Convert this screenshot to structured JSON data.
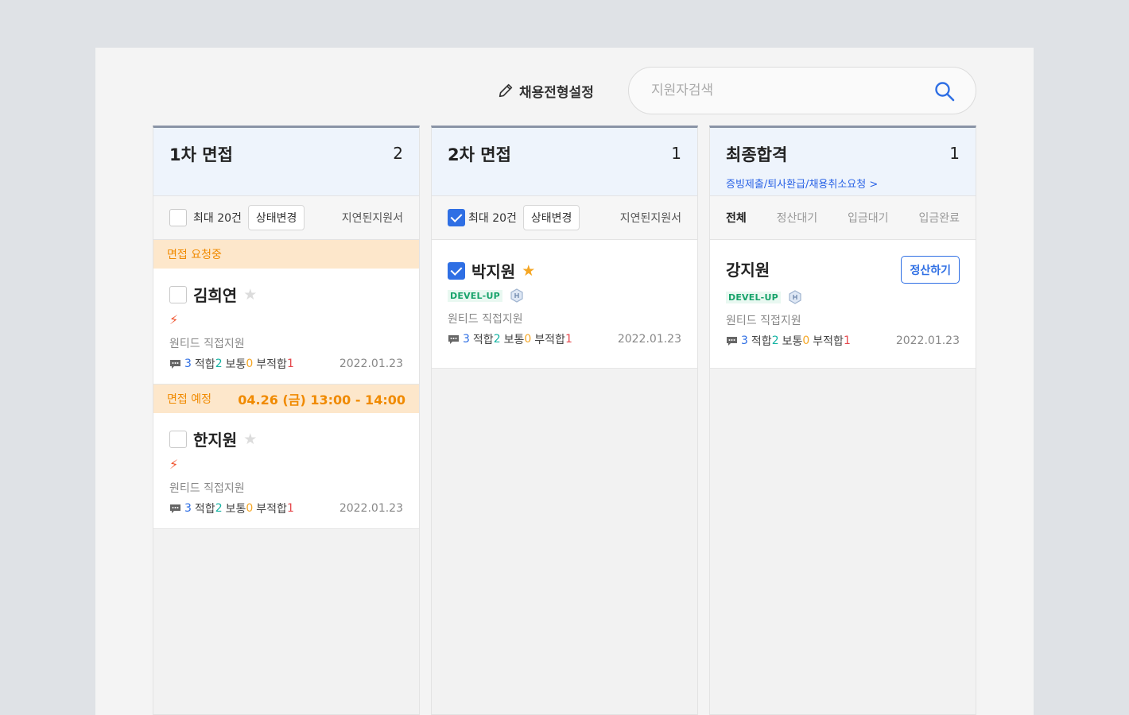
{
  "header": {
    "edit_label": "채용전형설정",
    "search_placeholder": "지원자검색"
  },
  "columns": [
    {
      "title": "1차 면접",
      "count": "2",
      "toolbar": {
        "max_label": "최대 20건",
        "status_button": "상태변경",
        "delayed_link": "지연된지원서",
        "checked": false
      },
      "groups": [
        {
          "band_label": "면접 요청중",
          "band_time": "",
          "card": {
            "name": "김희연",
            "starred": false,
            "source": "원티드 직접지원",
            "comments": "3",
            "fit_label": "적합",
            "fit": "2",
            "normal_label": "보통",
            "normal": "0",
            "unfit_label": "부적합",
            "unfit": "1",
            "date": "2022.01.23"
          }
        },
        {
          "band_label": "면접 예정",
          "band_time": "04.26 (금) 13:00 - 14:00",
          "card": {
            "name": "한지원",
            "starred": false,
            "source": "원티드 직접지원",
            "comments": "3",
            "fit_label": "적합",
            "fit": "2",
            "normal_label": "보통",
            "normal": "0",
            "unfit_label": "부적합",
            "unfit": "1",
            "date": "2022.01.23"
          }
        }
      ]
    },
    {
      "title": "2차 면접",
      "count": "1",
      "toolbar": {
        "max_label": "최대 20건",
        "status_button": "상태변경",
        "delayed_link": "지연된지원서",
        "checked": true
      },
      "card": {
        "name": "박지원",
        "starred": true,
        "badge": "DEVEL-UP",
        "source": "원티드 직접지원",
        "comments": "3",
        "fit_label": "적합",
        "fit": "2",
        "normal_label": "보통",
        "normal": "0",
        "unfit_label": "부적합",
        "unfit": "1",
        "date": "2022.01.23"
      }
    },
    {
      "title": "최종합격",
      "count": "1",
      "link": "증빙제출/퇴사환급/채용취소요청 >",
      "tabs": [
        "전체",
        "정산대기",
        "입금대기",
        "입금완료"
      ],
      "card": {
        "name": "강지원",
        "badge": "DEVEL-UP",
        "settle_button": "정산하기",
        "source": "원티드 직접지원",
        "comments": "3",
        "fit_label": "적합",
        "fit": "2",
        "normal_label": "보통",
        "normal": "0",
        "unfit_label": "부적합",
        "unfit": "1",
        "date": "2022.01.23"
      }
    }
  ],
  "colors": {
    "accent": "#2f6fe4",
    "band_bg": "#fde7cb",
    "band_text": "#f08a00",
    "header_bg": "#eef4fc"
  }
}
